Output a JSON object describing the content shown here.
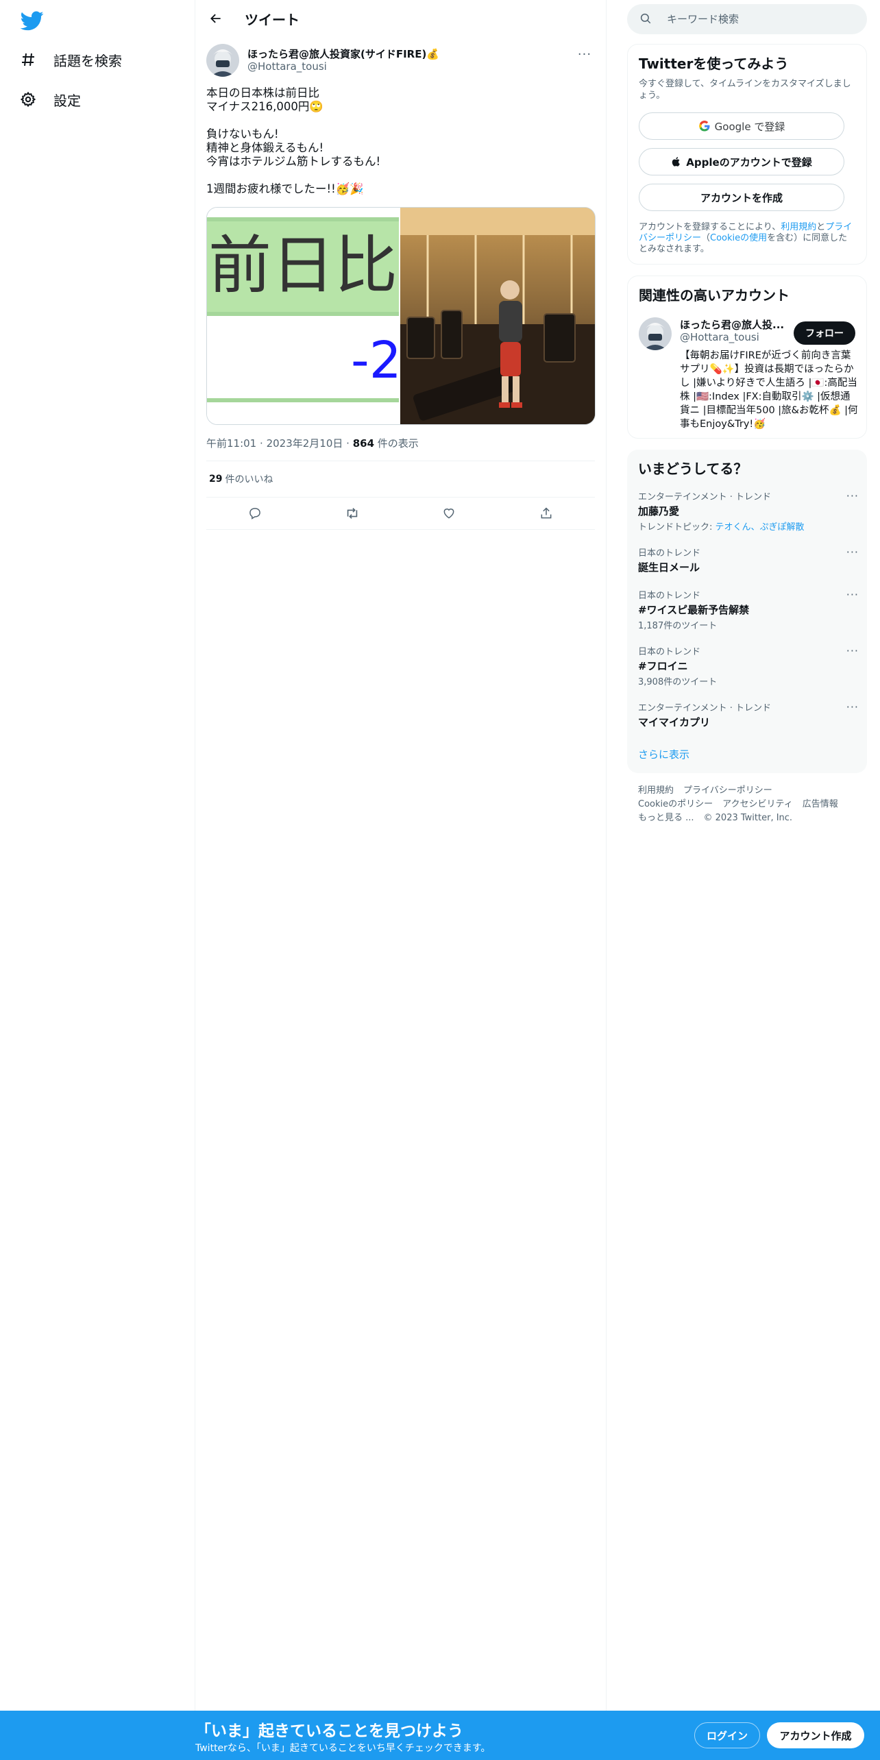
{
  "nav": {
    "items": [
      {
        "label": "話題を検索",
        "icon": "hashtag-icon"
      },
      {
        "label": "設定",
        "icon": "gear-icon"
      }
    ]
  },
  "header": {
    "title": "ツイート"
  },
  "tweet": {
    "author_name": "ほったら君@旅人投資家(サイドFIRE)",
    "author_badge_emoji": "💰",
    "author_handle": "@Hottara_tousi",
    "text": "本日の日本株は前日比\nマイナス216,000円🙄\n\n負けないもん!\n精神と身体鍛えるもん!\n今宵はホテルジム筋トレするもん!\n\n1週間お疲れ様でしたー!!🥳🎉",
    "media": {
      "left_text_top": "前日比",
      "left_text_bottom": "-2"
    },
    "time": "午前11:01",
    "date": "2023年2月10日",
    "views_count": "864",
    "views_label": "件の表示",
    "likes_count": "29",
    "likes_label": "件のいいね"
  },
  "search": {
    "placeholder": "キーワード検索"
  },
  "signup": {
    "title": "Twitterを使ってみよう",
    "desc": "今すぐ登録して、タイムラインをカスタマイズしましょう。",
    "google_label": "Google で登録",
    "apple_label": "Appleのアカウントで登録",
    "create_label": "アカウントを作成",
    "legal_prefix": "アカウントを登録することにより、",
    "legal_terms": "利用規約",
    "legal_and": "と",
    "legal_privacy": "プライバシーポリシー",
    "legal_paren_open": "（",
    "legal_cookie": "Cookieの使用",
    "legal_suffix": "を含む）に同意したとみなされます。"
  },
  "related": {
    "title": "関連性の高いアカウント",
    "name": "ほったら君@旅人投...",
    "handle": "@Hottara_tousi",
    "follow_label": "フォロー",
    "bio": "【毎朝お届けFIREが近づく前向き言葉サプリ💊✨】投資は長期でほったらかし |嫌いより好きで人生語ろ |🇯🇵:高配当株 |🇺🇸:Index |FX:自動取引⚙️ |仮想通貨ニ |目標配当年500 |旅&お乾杯💰 |何事もEnjoy&Try!🥳"
  },
  "trends": {
    "title": "いまどうしてる？",
    "items": [
      {
        "context": "エンターテインメント · トレンド",
        "name": "加藤乃愛",
        "meta_prefix": "トレンドトピック: ",
        "meta_link": "テオくん、ぷぎぽ解散"
      },
      {
        "context": "日本のトレンド",
        "name": "誕生日メール",
        "meta_prefix": "",
        "meta_link": ""
      },
      {
        "context": "日本のトレンド",
        "name": "#ワイスピ最新予告解禁",
        "meta_prefix": "1,187件のツイート",
        "meta_link": ""
      },
      {
        "context": "日本のトレンド",
        "name": "#フロイニ",
        "meta_prefix": "3,908件のツイート",
        "meta_link": ""
      },
      {
        "context": "エンターテインメント · トレンド",
        "name": "マイマイカプリ",
        "meta_prefix": "",
        "meta_link": ""
      }
    ],
    "show_more": "さらに表示"
  },
  "footer": {
    "links": [
      "利用規約",
      "プライバシーポリシー",
      "Cookieのポリシー",
      "アクセシビリティ",
      "広告情報",
      "もっと見る ...",
      "© 2023 Twitter, Inc."
    ]
  },
  "bottom_bar": {
    "title": "「いま」起きていることを見つけよう",
    "subtitle": "Twitterなら、「いま」起きていることをいち早くチェックできます。",
    "login": "ログイン",
    "signup": "アカウント作成"
  },
  "colors": {
    "brand": "#1d9bf0",
    "text": "#0f1419",
    "secondary": "#536471",
    "border": "#eff3f4",
    "media_green": "#b7e4a8",
    "media_number": "#1a1aff"
  }
}
